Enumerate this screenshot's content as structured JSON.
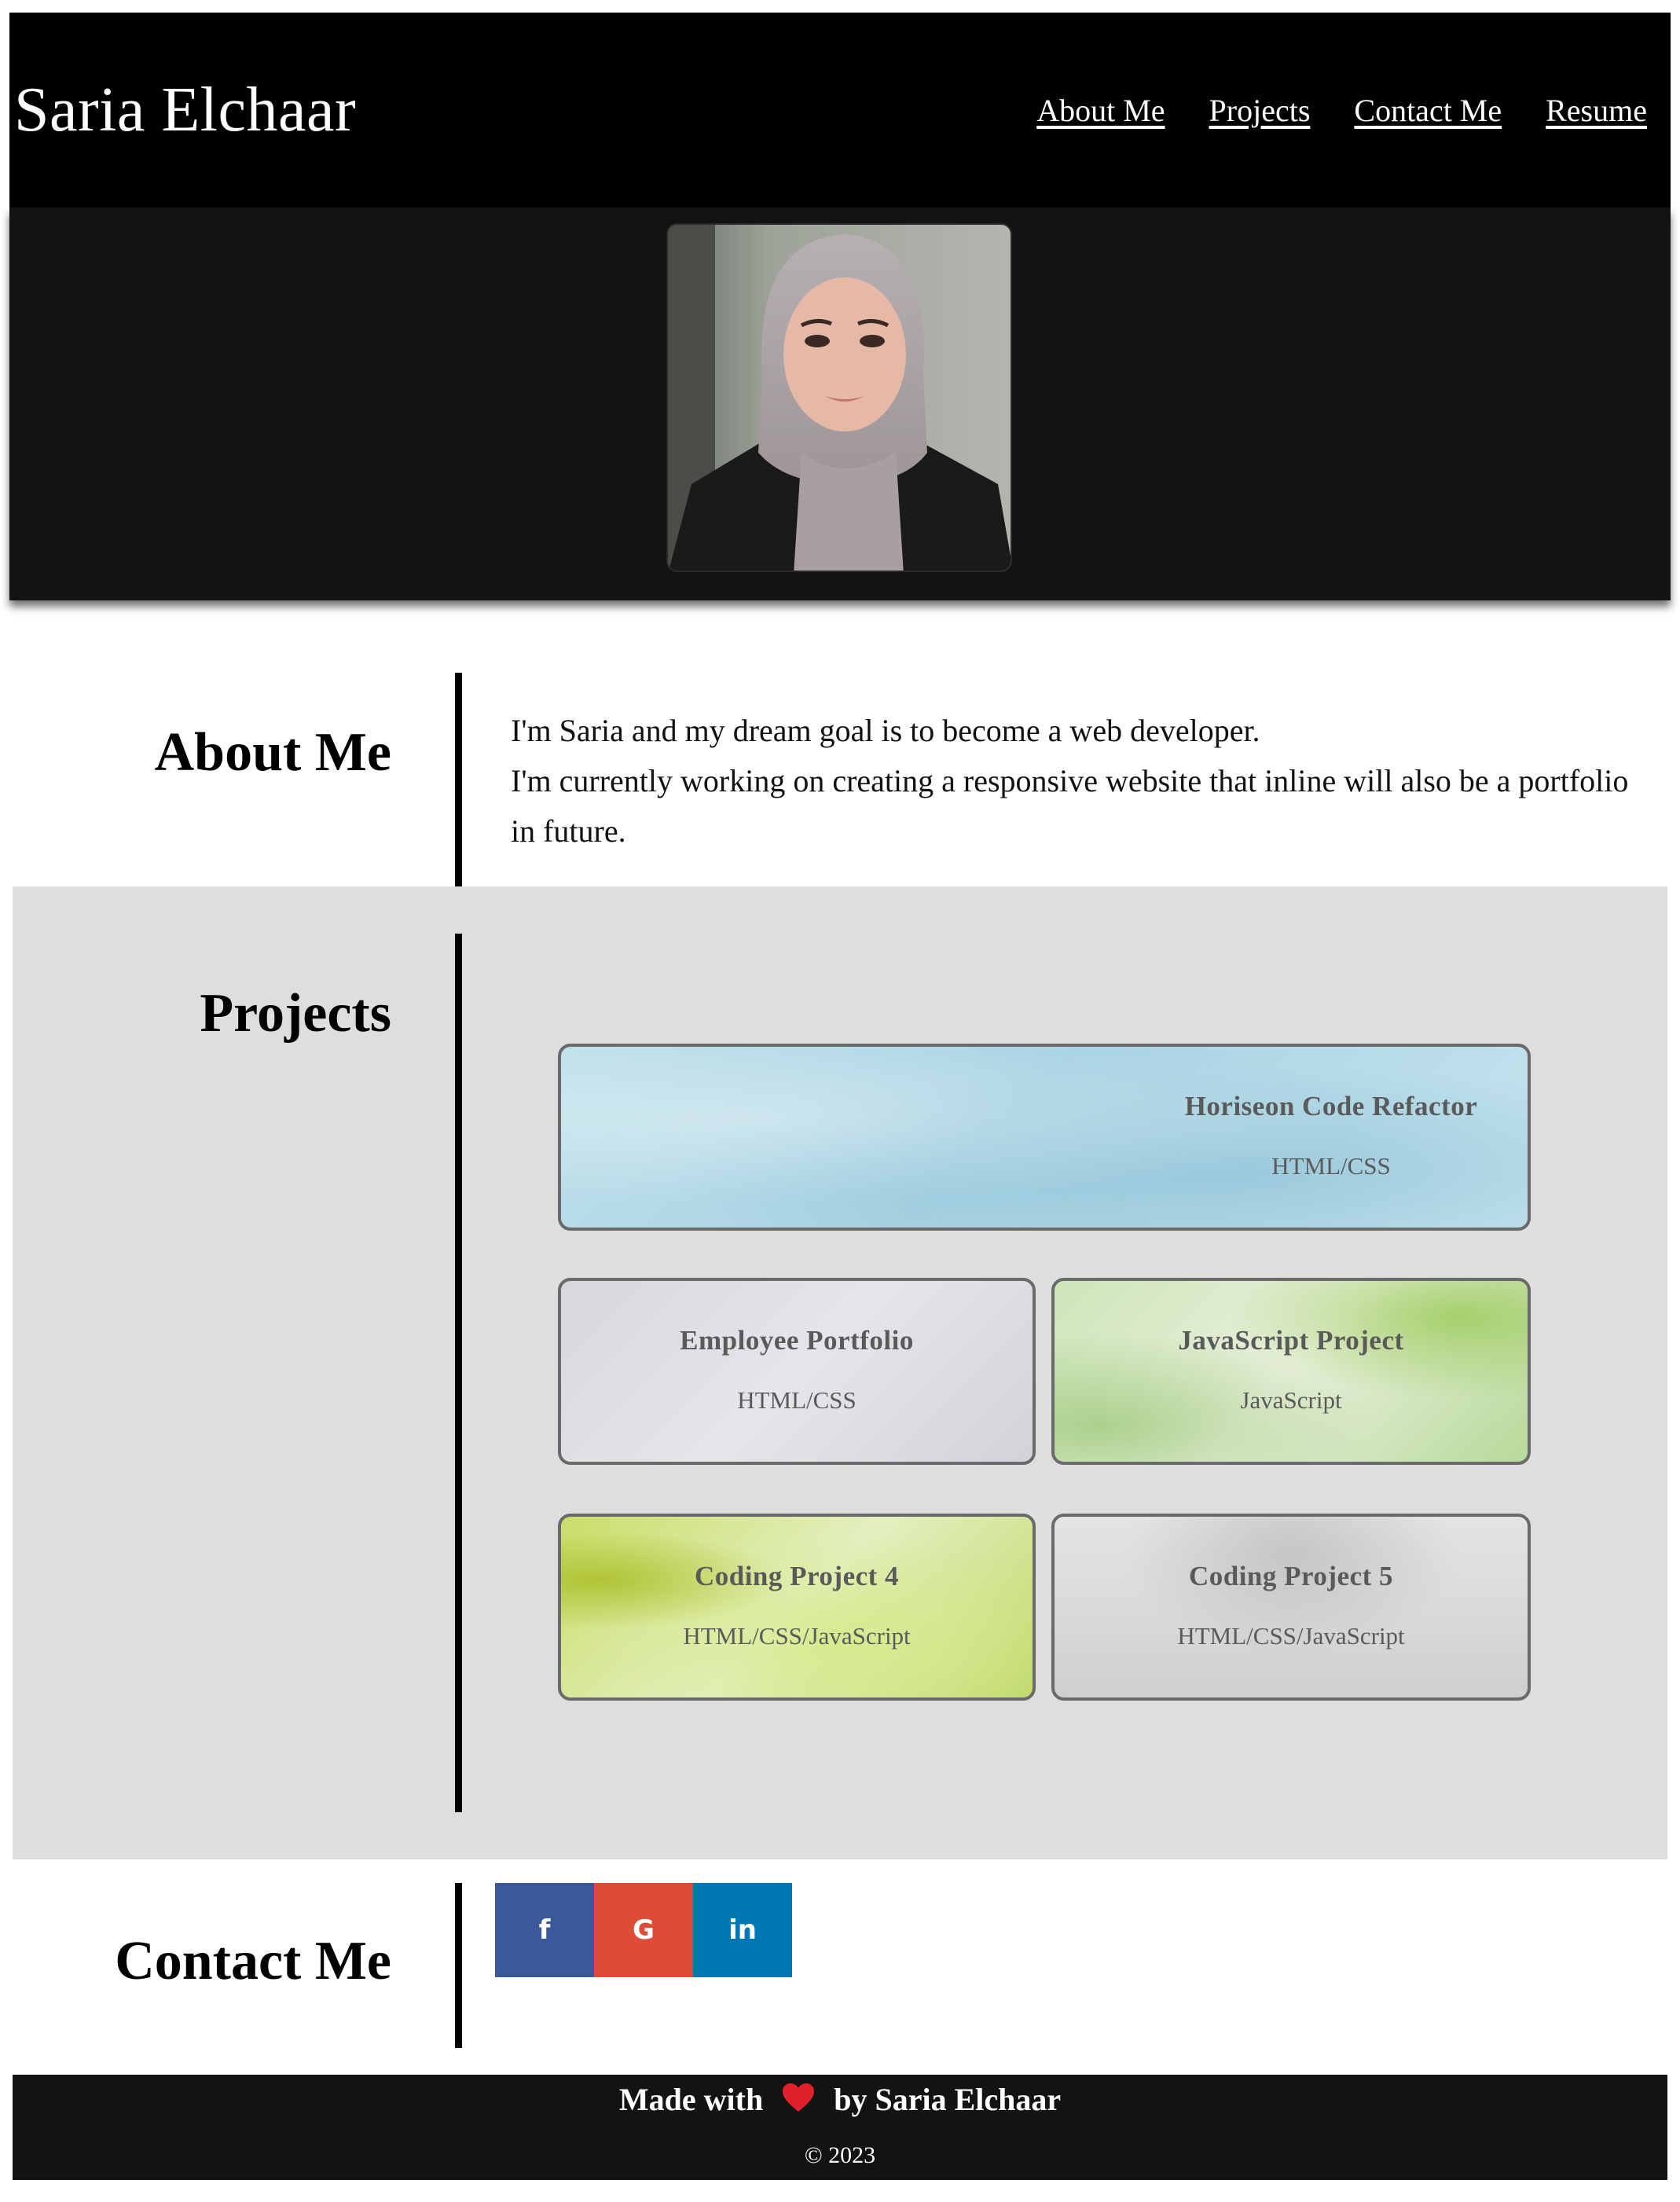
{
  "header": {
    "site_title": "Saria Elchaar",
    "nav": [
      "About Me",
      "Projects",
      "Contact Me",
      "Resume"
    ]
  },
  "hero": {
    "portrait_icon": "profile-photo"
  },
  "about": {
    "title": "About Me",
    "line1": "I'm Saria and my dream goal is to become a web developer.",
    "line2": "I'm currently working on creating a responsive website that inline will also be a portfolio in future."
  },
  "projects": {
    "title": "Projects",
    "cards": [
      {
        "title": "Horiseon Code Refactor",
        "tech": "HTML/CSS"
      },
      {
        "title": "Employee Portfolio",
        "tech": "HTML/CSS"
      },
      {
        "title": "JavaScript Project",
        "tech": "JavaScript"
      },
      {
        "title": "Coding Project 4",
        "tech": "HTML/CSS/JavaScript"
      },
      {
        "title": "Coding Project 5",
        "tech": "HTML/CSS/JavaScript"
      }
    ]
  },
  "contact": {
    "title": "Contact Me",
    "social": [
      {
        "glyph": "f",
        "icon": "facebook-icon",
        "color": "#3b5998"
      },
      {
        "glyph": "G",
        "icon": "google-icon",
        "color": "#dd4b39"
      },
      {
        "glyph": "in",
        "icon": "linkedin-icon",
        "color": "#0077b5"
      }
    ]
  },
  "footer": {
    "made_with": "Made with",
    "by": "by Saria Elchaar",
    "copyright": "© 2023",
    "heart_color": "#e0202b"
  }
}
